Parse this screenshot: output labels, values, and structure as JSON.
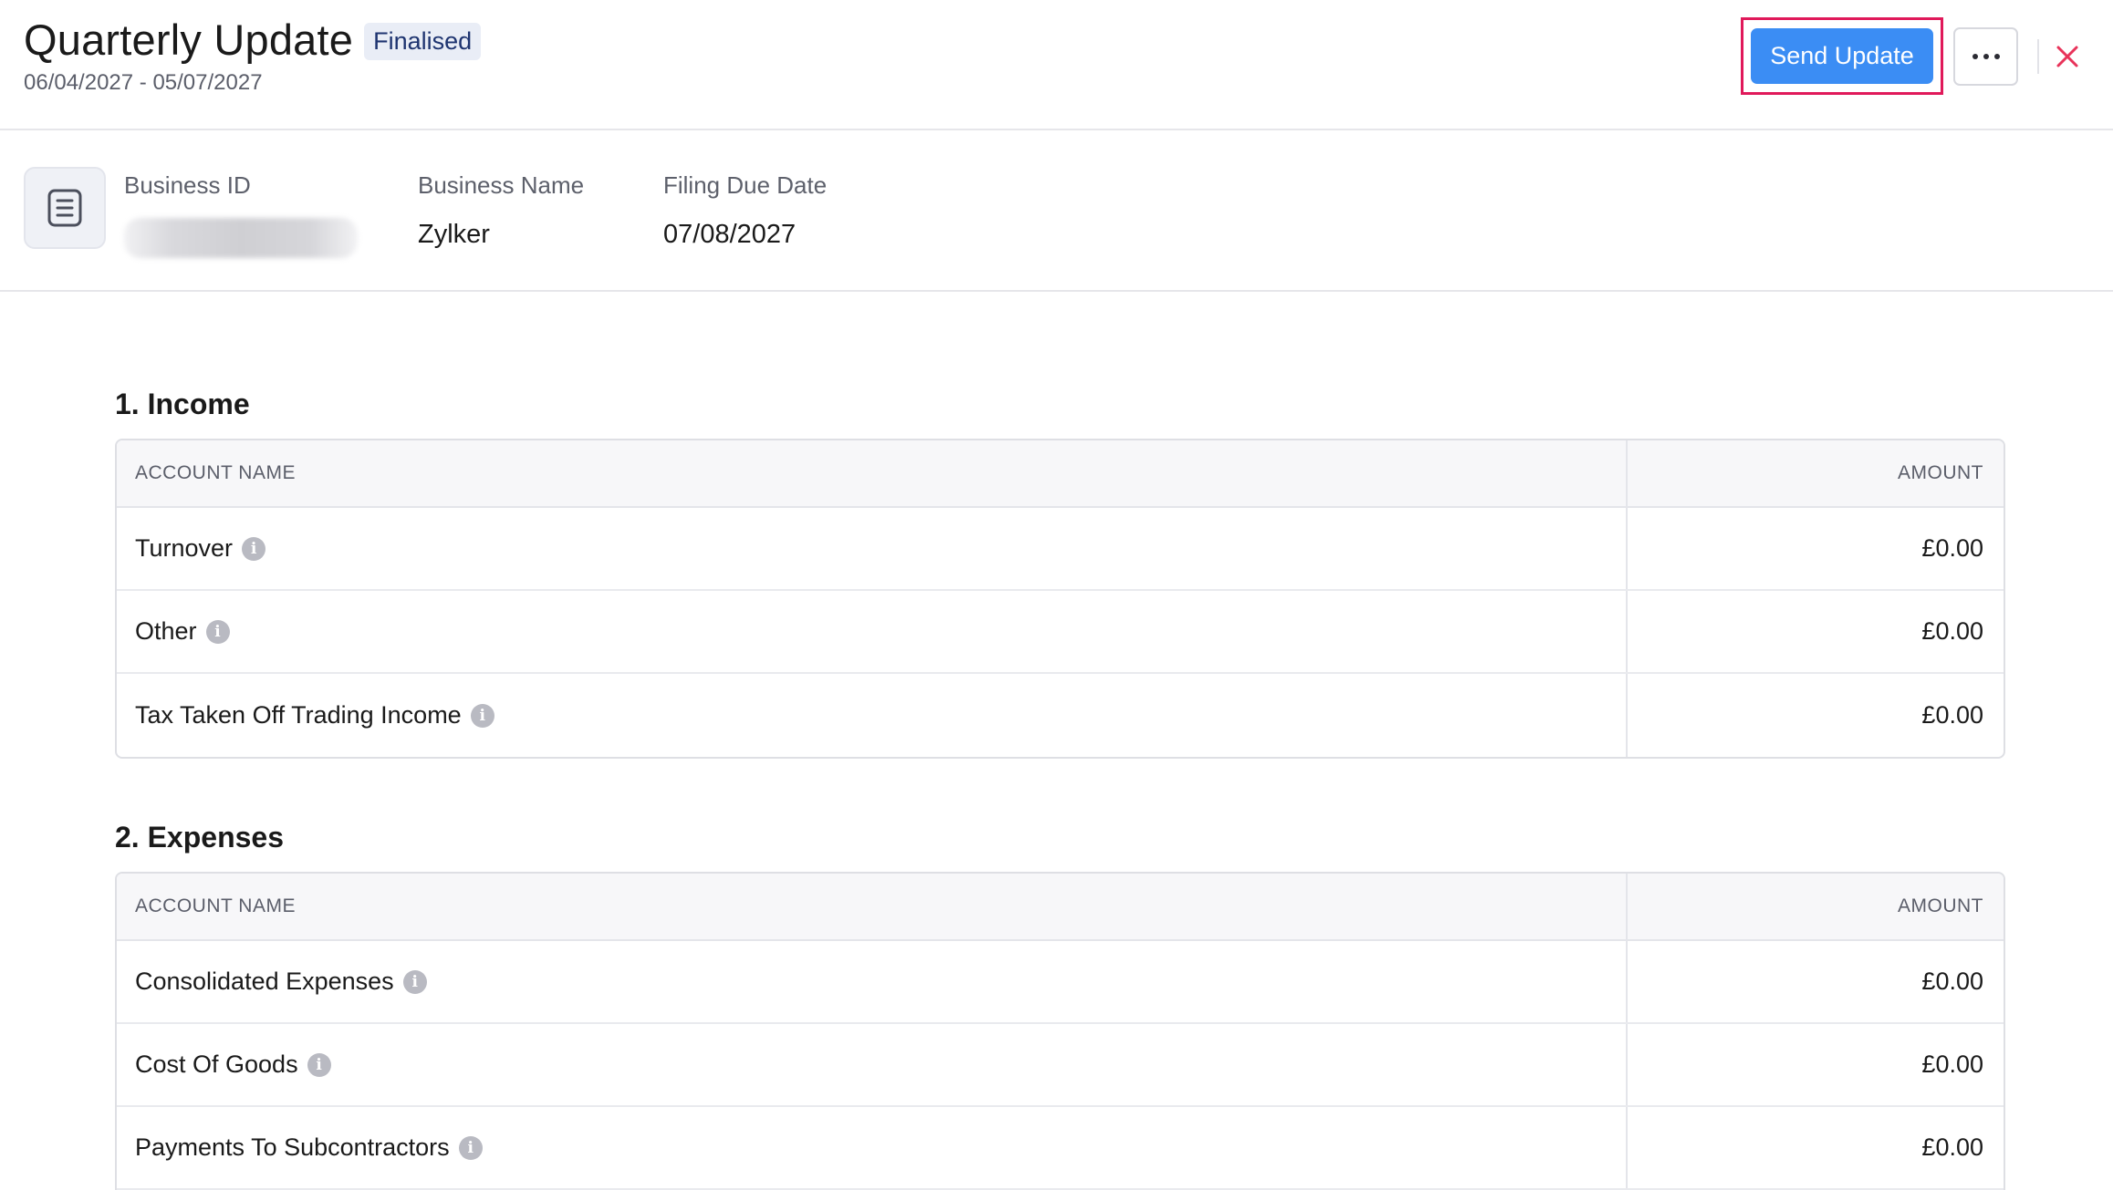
{
  "header": {
    "title": "Quarterly Update",
    "status": "Finalised",
    "date_range": "06/04/2027 - 05/07/2027",
    "send_label": "Send Update"
  },
  "meta": {
    "business_id_label": "Business ID",
    "business_name_label": "Business Name",
    "business_name": "Zylker",
    "filing_due_label": "Filing Due Date",
    "filing_due": "07/08/2027"
  },
  "income": {
    "title": "1. Income",
    "col_name": "ACCOUNT NAME",
    "col_amount": "AMOUNT",
    "rows": [
      {
        "name": "Turnover",
        "amount": "£0.00"
      },
      {
        "name": "Other",
        "amount": "£0.00"
      },
      {
        "name": "Tax Taken Off Trading Income",
        "amount": "£0.00"
      }
    ]
  },
  "expenses": {
    "title": "2. Expenses",
    "col_name": "ACCOUNT NAME",
    "col_amount": "AMOUNT",
    "rows": [
      {
        "name": "Consolidated Expenses",
        "amount": "£0.00"
      },
      {
        "name": "Cost Of Goods",
        "amount": "£0.00"
      },
      {
        "name": "Payments To Subcontractors",
        "amount": "£0.00"
      }
    ]
  },
  "colors": {
    "accent": "#3b8df4",
    "highlight": "#e0195a",
    "close": "#e8335a"
  }
}
